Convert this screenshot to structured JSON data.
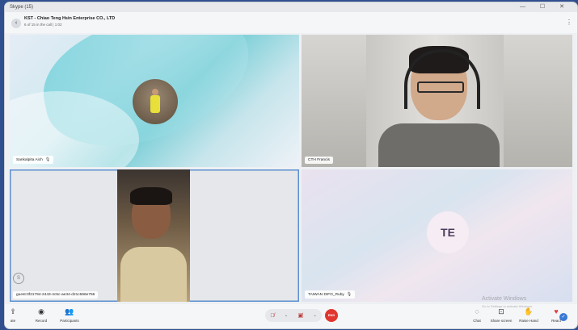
{
  "window": {
    "title": "Skype (15)",
    "controls": "— ☐ ✕"
  },
  "header": {
    "title": "KST - Chiao Teng Hsin Enterprise CO., LTD",
    "subtitle": "6 of 15 in the call | 1:02",
    "back_icon": "‹",
    "more_icon": "⋮"
  },
  "participants": [
    {
      "name": "Sankalpita Aich",
      "mute_icon": "🎙"
    },
    {
      "name": "CTH Francis"
    },
    {
      "name": "guest:0f21794-2443-4c5c-ae34-d21c666e756",
      "badge": "S"
    },
    {
      "name": "TAIWAN DIFO_Ruby",
      "initials": "TE",
      "mute_icon": "🎙"
    }
  ],
  "toolbar": {
    "left": [
      {
        "icon": "⇪",
        "label": "ate"
      },
      {
        "icon": "◉",
        "label": "Record"
      },
      {
        "icon": "👥",
        "label": "Participants"
      }
    ],
    "center": {
      "mic": "🎙̸",
      "cam": "▣̸",
      "dropdown": "⌄",
      "end_label": "END"
    },
    "right": [
      {
        "icon": "◌",
        "label": "Chat"
      },
      {
        "icon": "⊡",
        "label": "Share screen"
      },
      {
        "icon": "✋",
        "label": "Raise Hand"
      },
      {
        "icon": "♥",
        "label": "React"
      }
    ]
  },
  "watermark": {
    "line1": "Activate Windows",
    "line2": "Go to Settings to activate Windows."
  },
  "colors": {
    "end_call": "#e0362f",
    "active_border": "#5b8fcf",
    "react": "#3a78d6"
  }
}
